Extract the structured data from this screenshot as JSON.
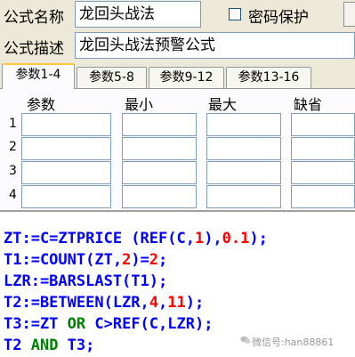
{
  "form": {
    "name_label": "公式名称",
    "name_value": "龙回头战法",
    "password_label": "密码保护",
    "desc_label": "公式描述",
    "desc_value": "龙回头战法预警公式"
  },
  "tabs": [
    {
      "label": "参数1-4",
      "active": true
    },
    {
      "label": "参数5-8",
      "active": false
    },
    {
      "label": "参数9-12",
      "active": false
    },
    {
      "label": "参数13-16",
      "active": false
    }
  ],
  "params": {
    "headers": [
      "参数",
      "最小",
      "最大",
      "缺省"
    ],
    "rows": [
      "1",
      "2",
      "3",
      "4"
    ]
  },
  "code": {
    "line1": {
      "a": "ZT:=C=ZTPRICE (REF(C,",
      "b": "1",
      "c": "),",
      "d": "0.1",
      "e": ");"
    },
    "line2": {
      "a": "T1:=COUNT(ZT,",
      "b": "2",
      "c": ")=",
      "d": "2",
      "e": ";"
    },
    "line3": {
      "a": "LZR:=BARSLAST(T1);"
    },
    "line4": {
      "a": "T2:=BETWEEN(LZR,",
      "b": "4",
      "c": ",",
      "d": "11",
      "e": ");"
    },
    "line5": {
      "a": "T3:=ZT ",
      "b": "OR",
      "c": " C>REF(C,LZR);"
    },
    "line6": {
      "a": "T2 ",
      "b": "AND",
      "c": " T3;"
    }
  },
  "watermark": "微信号:han88861"
}
